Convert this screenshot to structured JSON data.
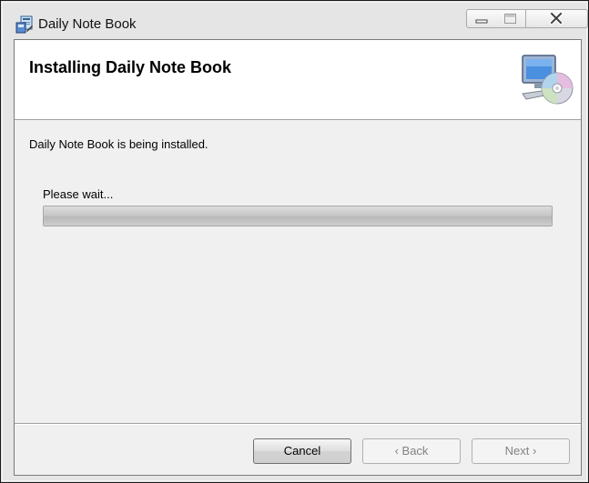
{
  "window": {
    "title": "Daily Note Book",
    "app_icon": "installer-icon",
    "controls": {
      "minimize_icon": "minimize-icon",
      "maximize_icon": "maximize-icon",
      "close_icon": "close-icon"
    }
  },
  "banner": {
    "title": "Installing Daily Note Book",
    "icon": "computer-cd-icon"
  },
  "body": {
    "status": "Daily Note Book is being installed.",
    "wait_label": "Please wait...",
    "progress": 1.0
  },
  "buttons": {
    "cancel": "Cancel",
    "back": "Back",
    "back_icon": "chevron-left-icon",
    "next": "Next",
    "next_icon": "chevron-right-icon"
  },
  "colors": {
    "window_frame": "#1a1a1a",
    "client_bg": "#f0f0f0",
    "banner_bg": "#ffffff",
    "disabled_text": "#838383"
  }
}
